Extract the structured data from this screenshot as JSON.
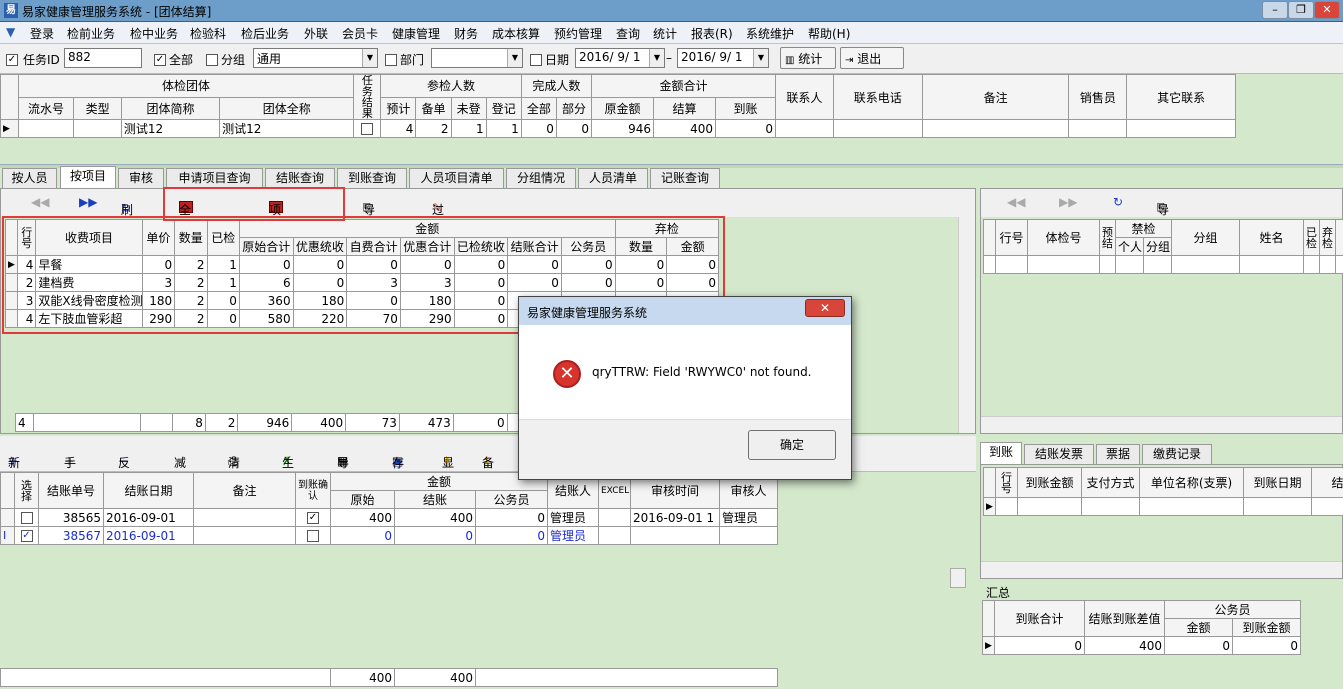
{
  "window": {
    "title": "易家健康管理服务系统 - [团体结算]"
  },
  "menu": [
    "登录",
    "检前业务",
    "检中业务",
    "检验科",
    "检后业务",
    "外联",
    "会员卡",
    "健康管理",
    "财务",
    "成本核算",
    "预约管理",
    "查询",
    "统计",
    "报表(R)",
    "系统维护",
    "帮助(H)"
  ],
  "filter": {
    "task_id_label": "任务ID",
    "task_id": "882",
    "all_label": "全部",
    "group_label": "分组",
    "group_value": "通用",
    "dept_label": "部门",
    "dept_value": "",
    "date_label": "日期",
    "date_from": "2016/ 9/ 1",
    "date_to": "2016/ 9/ 1",
    "stats_btn": "统计",
    "exit_btn": "退出"
  },
  "top_grid": {
    "group_headers": {
      "team": "体检团体",
      "task_result": "任务结果",
      "participants": "参检人数",
      "completed": "完成人数",
      "amount": "金额合计"
    },
    "headers": {
      "serial": "流水号",
      "type": "类型",
      "short_name": "团体简称",
      "full_name": "团体全称",
      "estimate": "预计",
      "registered": "备单",
      "not_reg": "未登",
      "reg": "登记",
      "all": "全部",
      "part": "部分",
      "orig": "原金额",
      "settled": "结算",
      "arrived": "到账",
      "contact": "联系人",
      "phone": "联系电话",
      "remark": "备注",
      "sales": "销售员",
      "other": "其它联系"
    },
    "row": {
      "serial": "",
      "type": "",
      "short_name": "测试12",
      "full_name": "测试12",
      "estimate": "4",
      "registered": "2",
      "not_reg": "1",
      "reg": "1",
      "all": "0",
      "part": "0",
      "orig": "946",
      "settled": "400",
      "arrived": "0"
    }
  },
  "tabs": [
    "按人员",
    "按项目",
    "审核",
    "申请项目查询",
    "结账查询",
    "到账查询",
    "人员项目清单",
    "分组情况",
    "人员清单",
    "记账查询"
  ],
  "tb2": {
    "refresh": "刷新",
    "all_total": "全部总额",
    "item_total": "项目总额",
    "export": "导出",
    "filter": "过滤"
  },
  "item_grid": {
    "headers": {
      "row": "行号",
      "item": "收费项目",
      "price": "单价",
      "qty": "数量",
      "checked": "已检",
      "amount": "金额",
      "orig_total": "原始合计",
      "disc_total": "优惠统收",
      "self_total": "自费合计",
      "pref_total": "优惠合计",
      "checked_total": "已检统收",
      "settle_total": "结账合计",
      "civil": "公务员",
      "abandon": "弃检",
      "ab_qty": "数量",
      "ab_amount": "金额"
    },
    "rows": [
      {
        "no": "4",
        "item": "早餐",
        "price": "0",
        "qty": "2",
        "checked": "1",
        "orig": "0",
        "disc": "0",
        "self": "0",
        "pref": "0",
        "chk": "0",
        "settle": "0",
        "civil": "0",
        "abq": "0",
        "aba": "0"
      },
      {
        "no": "2",
        "item": "建档费",
        "price": "3",
        "qty": "2",
        "checked": "1",
        "orig": "6",
        "disc": "0",
        "self": "3",
        "pref": "3",
        "chk": "0",
        "settle": "0",
        "civil": "0",
        "abq": "0",
        "aba": "0"
      },
      {
        "no": "3",
        "item": "双能X线骨密度检测",
        "price": "180",
        "qty": "2",
        "checked": "0",
        "orig": "360",
        "disc": "180",
        "self": "0",
        "pref": "180",
        "chk": "0",
        "settle": "",
        "civil": "",
        "abq": "",
        "aba": ""
      },
      {
        "no": "4",
        "item": "左下肢血管彩超",
        "price": "290",
        "qty": "2",
        "checked": "0",
        "orig": "580",
        "disc": "220",
        "self": "70",
        "pref": "290",
        "chk": "0",
        "settle": "",
        "civil": "",
        "abq": "",
        "aba": ""
      }
    ],
    "footer": {
      "no": "4",
      "qty": "8",
      "checked": "2",
      "orig": "946",
      "disc": "400",
      "self": "73",
      "pref": "473",
      "chk": "0"
    }
  },
  "right_grid": {
    "headers": {
      "row": "行号",
      "exam_no": "体检号",
      "pre": "预结",
      "ban": "禁检",
      "personal": "个人",
      "group": "分组",
      "grp": "分组",
      "name": "姓名",
      "checked": "已检",
      "abandon": "弃检"
    },
    "export": "导出"
  },
  "tb3": {
    "new": "新结",
    "manual": "手工",
    "reverse": "反结",
    "reduce": "减免",
    "clear": "清单",
    "generate": "生成",
    "export": "导出",
    "save": "存入",
    "show": "显",
    "prep": "备"
  },
  "settle_grid": {
    "headers": {
      "sel": "选择",
      "no": "结账单号",
      "date": "结账日期",
      "remark": "备注",
      "confirm": "到账确认",
      "amount": "金额",
      "orig": "原始",
      "settled": "结账",
      "civil": "公务员",
      "person": "结账人",
      "excel": "EXCEL",
      "audit_time": "审核时间",
      "auditor": "审核人"
    },
    "rows": [
      {
        "no": "38565",
        "date": "2016-09-01",
        "orig": "400",
        "settled": "400",
        "civil": "0",
        "person": "管理员",
        "audit_time": "2016-09-01 1",
        "auditor": "管理员"
      },
      {
        "no": "38567",
        "date": "2016-09-01",
        "orig": "0",
        "settled": "0",
        "civil": "0",
        "person": "管理员",
        "audit_time": "",
        "auditor": ""
      }
    ],
    "footer": {
      "orig": "400",
      "settled": "400"
    }
  },
  "right_tabs": [
    "到账",
    "结账发票",
    "票据",
    "缴费记录"
  ],
  "arrival_grid": {
    "headers": {
      "row": "行号",
      "amount": "到账金额",
      "method": "支付方式",
      "unit": "单位名称(支票)",
      "date": "到账日期",
      "c": "结"
    }
  },
  "summary": {
    "label": "汇总",
    "headers": {
      "arrived": "到账合计",
      "diff": "结账到账差值",
      "civil": "公务员",
      "amount": "金额",
      "arrived_amount": "到账金额"
    },
    "values": {
      "arrived": "0",
      "diff": "400",
      "amount": "0",
      "arrived_amount": "0"
    }
  },
  "dialog": {
    "title": "易家健康管理服务系统",
    "message": "qryTTRW: Field 'RWYWC0' not found.",
    "ok": "确定",
    "close": "✕"
  }
}
